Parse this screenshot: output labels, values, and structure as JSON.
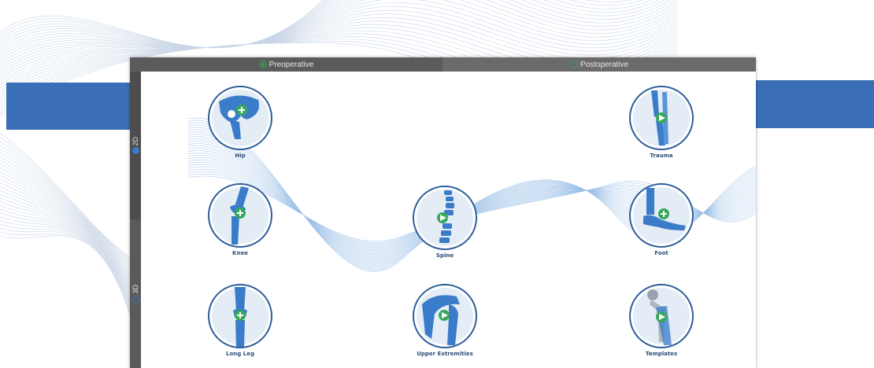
{
  "tabs": [
    {
      "label": "Preoperative",
      "selected": true
    },
    {
      "label": "Postoperative",
      "selected": false
    }
  ],
  "side_tabs": [
    {
      "label": "2D",
      "selected": true
    },
    {
      "label": "3D",
      "selected": false
    }
  ],
  "modules": [
    {
      "label": "Hip",
      "icon": "hip-icon",
      "action": "plus-icon"
    },
    {
      "label": "Trauma",
      "icon": "trauma-icon",
      "action": "play-icon"
    },
    {
      "label": "Knee",
      "icon": "knee-icon",
      "action": "plus-icon"
    },
    {
      "label": "Spine",
      "icon": "spine-icon",
      "action": "play-icon"
    },
    {
      "label": "Foot",
      "icon": "foot-icon",
      "action": "plus-icon"
    },
    {
      "label": "Long Leg",
      "icon": "long-leg-icon",
      "action": "plus-icon"
    },
    {
      "label": "Upper Extremities",
      "icon": "upper-extremities-icon",
      "action": "play-icon"
    },
    {
      "label": "Templates",
      "icon": "templates-icon",
      "action": "play-icon"
    }
  ],
  "colors": {
    "accent_blue": "#3a6fb7",
    "bone_blue": "#3a7cc9",
    "action_green": "#37a85b",
    "toolbar_gray": "#4a4a4a"
  }
}
